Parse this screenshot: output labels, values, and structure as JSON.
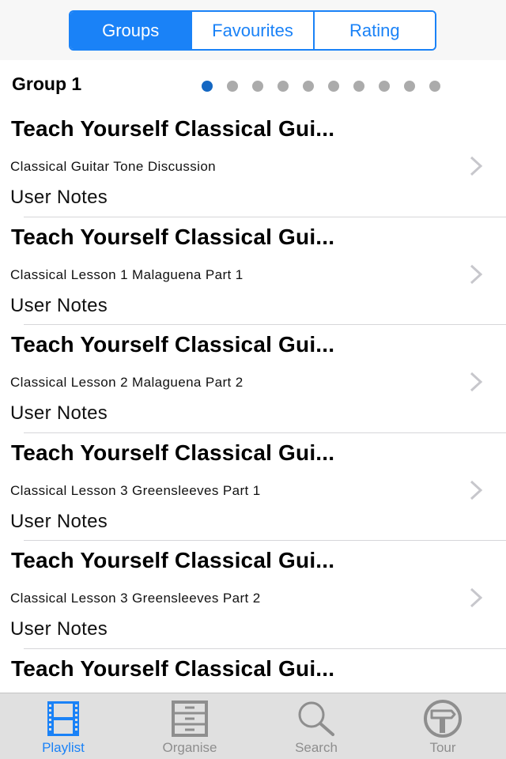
{
  "header": {
    "segments": [
      {
        "label": "Groups",
        "active": true
      },
      {
        "label": "Favourites",
        "active": false
      },
      {
        "label": "Rating",
        "active": false
      }
    ]
  },
  "group": {
    "title": "Group 1",
    "page_count": 10,
    "current_page": 1
  },
  "colors": {
    "accent": "#1a82f7",
    "page_dot_active": "#1467c2",
    "page_dot_inactive": "#ababab",
    "tab_inactive": "#8e8e8e"
  },
  "list": {
    "items": [
      {
        "title": "Teach Yourself Classical Gui...",
        "subtitle": "Classical Guitar Tone Discussion",
        "notes": "User Notes"
      },
      {
        "title": "Teach Yourself Classical Gui...",
        "subtitle": "Classical Lesson 1 Malaguena Part 1",
        "notes": "User Notes"
      },
      {
        "title": "Teach Yourself Classical Gui...",
        "subtitle": "Classical Lesson 2 Malaguena Part 2",
        "notes": "User Notes"
      },
      {
        "title": "Teach Yourself Classical Gui...",
        "subtitle": "Classical Lesson 3 Greensleeves Part 1",
        "notes": "User Notes"
      },
      {
        "title": "Teach Yourself Classical Gui...",
        "subtitle": "Classical Lesson 3 Greensleeves Part 2",
        "notes": "User Notes"
      },
      {
        "title": "Teach Yourself Classical Gui..."
      }
    ]
  },
  "tabbar": {
    "tabs": [
      {
        "label": "Playlist",
        "icon": "film-strip-icon",
        "active": true
      },
      {
        "label": "Organise",
        "icon": "filing-cabinet-icon",
        "active": false
      },
      {
        "label": "Search",
        "icon": "magnifying-glass-icon",
        "active": false
      },
      {
        "label": "Tour",
        "icon": "signpost-icon",
        "active": false
      }
    ]
  }
}
